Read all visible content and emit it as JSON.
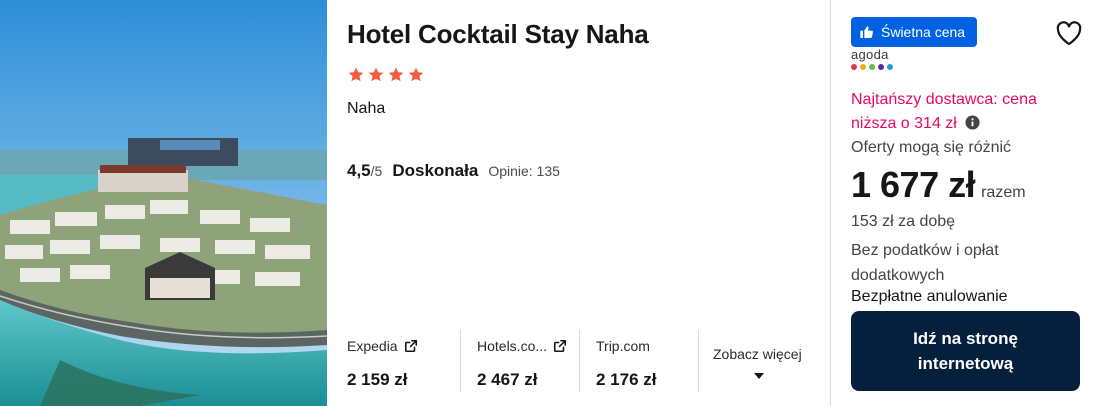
{
  "hotel": {
    "name": "Hotel Cocktail Stay Naha",
    "stars": 4,
    "city": "Naha",
    "rating_score": "4,5",
    "rating_max": "/5",
    "rating_word": "Doskonała",
    "reviews": "Opinie: 135"
  },
  "providers": [
    {
      "name": "Expedia",
      "price": "2 159 zł"
    },
    {
      "name": "Hotels.co...",
      "price": "2 467 zł"
    },
    {
      "name": "Trip.com",
      "price": "2 176 zł"
    }
  ],
  "see_more": "Zobacz więcej",
  "deal": {
    "badge": "Świetna cena",
    "provider_logo": "agoda",
    "cheapest": "Najtańszy dostawca: cena niższa o 314 zł",
    "offers_vary": "Oferty mogą się różnić",
    "price": "1 677 zł",
    "price_unit": "razem",
    "per_night": "153 zł za dobę",
    "taxes": "Bez podatków i opłat dodatkowych",
    "free_cancel": "Bezpłatne anulowanie",
    "cta": "Idź na stronę internetową"
  },
  "colors": {
    "star": "#f55d42",
    "badge": "#0062e3",
    "cheapest": "#e70866",
    "cta": "#05203c"
  },
  "icons": [
    "star-icon",
    "external-link-icon",
    "caret-down-icon",
    "thumbs-up-icon",
    "heart-icon",
    "info-icon"
  ]
}
